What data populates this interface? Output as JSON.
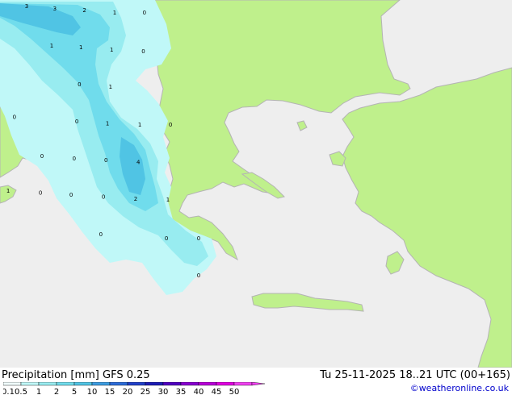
{
  "map": {
    "sea_color": "#eeeeee",
    "land_color": "#bff08c",
    "coast_color": "#b4b4b4",
    "precip_shades": [
      "#c0f8f8",
      "#98ecf0",
      "#70dcec",
      "#50c4e4"
    ],
    "values": [
      {
        "text": "3",
        "x": 0.052,
        "y": 0.022
      },
      {
        "text": "3",
        "x": 0.107,
        "y": 0.028
      },
      {
        "text": "2",
        "x": 0.165,
        "y": 0.033
      },
      {
        "text": "1",
        "x": 0.224,
        "y": 0.039
      },
      {
        "text": "0",
        "x": 0.282,
        "y": 0.039
      },
      {
        "text": "1",
        "x": 0.101,
        "y": 0.129
      },
      {
        "text": "1",
        "x": 0.158,
        "y": 0.134
      },
      {
        "text": "1",
        "x": 0.218,
        "y": 0.14
      },
      {
        "text": "0",
        "x": 0.28,
        "y": 0.145
      },
      {
        "text": "0",
        "x": 0.155,
        "y": 0.235
      },
      {
        "text": "1",
        "x": 0.216,
        "y": 0.241
      },
      {
        "text": "0",
        "x": 0.028,
        "y": 0.324
      },
      {
        "text": "0",
        "x": 0.15,
        "y": 0.336
      },
      {
        "text": "1",
        "x": 0.21,
        "y": 0.341
      },
      {
        "text": "1",
        "x": 0.273,
        "y": 0.344
      },
      {
        "text": "0",
        "x": 0.333,
        "y": 0.344
      },
      {
        "text": "0",
        "x": 0.082,
        "y": 0.43
      },
      {
        "text": "0",
        "x": 0.145,
        "y": 0.436
      },
      {
        "text": "0",
        "x": 0.207,
        "y": 0.441
      },
      {
        "text": "4",
        "x": 0.27,
        "y": 0.446
      },
      {
        "text": "1",
        "x": 0.016,
        "y": 0.524
      },
      {
        "text": "0",
        "x": 0.079,
        "y": 0.53
      },
      {
        "text": "0",
        "x": 0.139,
        "y": 0.535
      },
      {
        "text": "0",
        "x": 0.202,
        "y": 0.541
      },
      {
        "text": "2",
        "x": 0.265,
        "y": 0.546
      },
      {
        "text": "1",
        "x": 0.328,
        "y": 0.548
      },
      {
        "text": "0",
        "x": 0.197,
        "y": 0.643
      },
      {
        "text": "0",
        "x": 0.325,
        "y": 0.654
      },
      {
        "text": "0",
        "x": 0.388,
        "y": 0.654
      },
      {
        "text": "0",
        "x": 0.388,
        "y": 0.754
      }
    ]
  },
  "footer": {
    "title": "Precipitation [mm]  GFS 0.25",
    "run": "Tu 25-11-2025 18..21 UTC (00+165)",
    "credit": "©weatheronline.co.uk"
  },
  "legend": {
    "labels": [
      "0.1",
      "0.5",
      "1",
      "2",
      "5",
      "10",
      "15",
      "20",
      "25",
      "30",
      "35",
      "40",
      "45",
      "50"
    ],
    "colors": [
      "#f0fcfc",
      "#c0f8f8",
      "#98ecf0",
      "#70dcec",
      "#50c4e4",
      "#3c9ce0",
      "#2c6cd8",
      "#2040c8",
      "#1c1cb4",
      "#5000c0",
      "#8800d0",
      "#b800d8",
      "#e000e0",
      "#f040f0"
    ]
  }
}
